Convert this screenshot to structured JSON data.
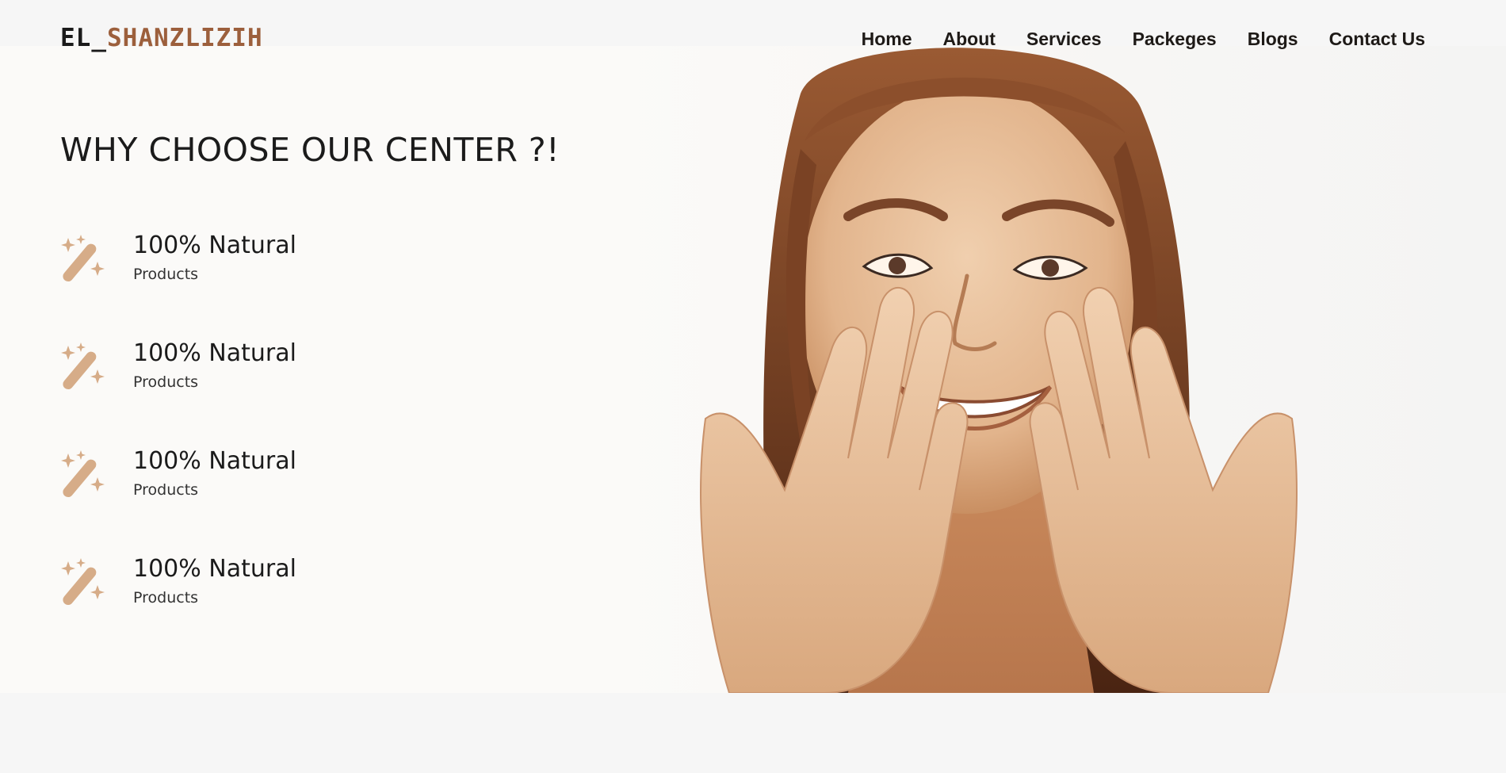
{
  "brand": {
    "part1": "EL_",
    "part2": "SHANZLIZIH",
    "colors": {
      "dark": "#1b1b1b",
      "accent": "#9c5f3c"
    }
  },
  "nav": {
    "items": [
      "Home",
      "About",
      "Services",
      "Packeges",
      "Blogs",
      "Contact Us"
    ]
  },
  "hero": {
    "heading": "WHY CHOOSE OUR CENTER ?!",
    "features": [
      {
        "title": "100% Natural",
        "subtitle": "Products",
        "icon": "magic-wand-sparkles-icon"
      },
      {
        "title": "100% Natural",
        "subtitle": "Products",
        "icon": "magic-wand-sparkles-icon"
      },
      {
        "title": "100% Natural",
        "subtitle": "Products",
        "icon": "magic-wand-sparkles-icon"
      },
      {
        "title": "100% Natural",
        "subtitle": "Products",
        "icon": "magic-wand-sparkles-icon"
      }
    ],
    "icon_color": "#d6ac88",
    "tone_color": "#b8764f"
  }
}
